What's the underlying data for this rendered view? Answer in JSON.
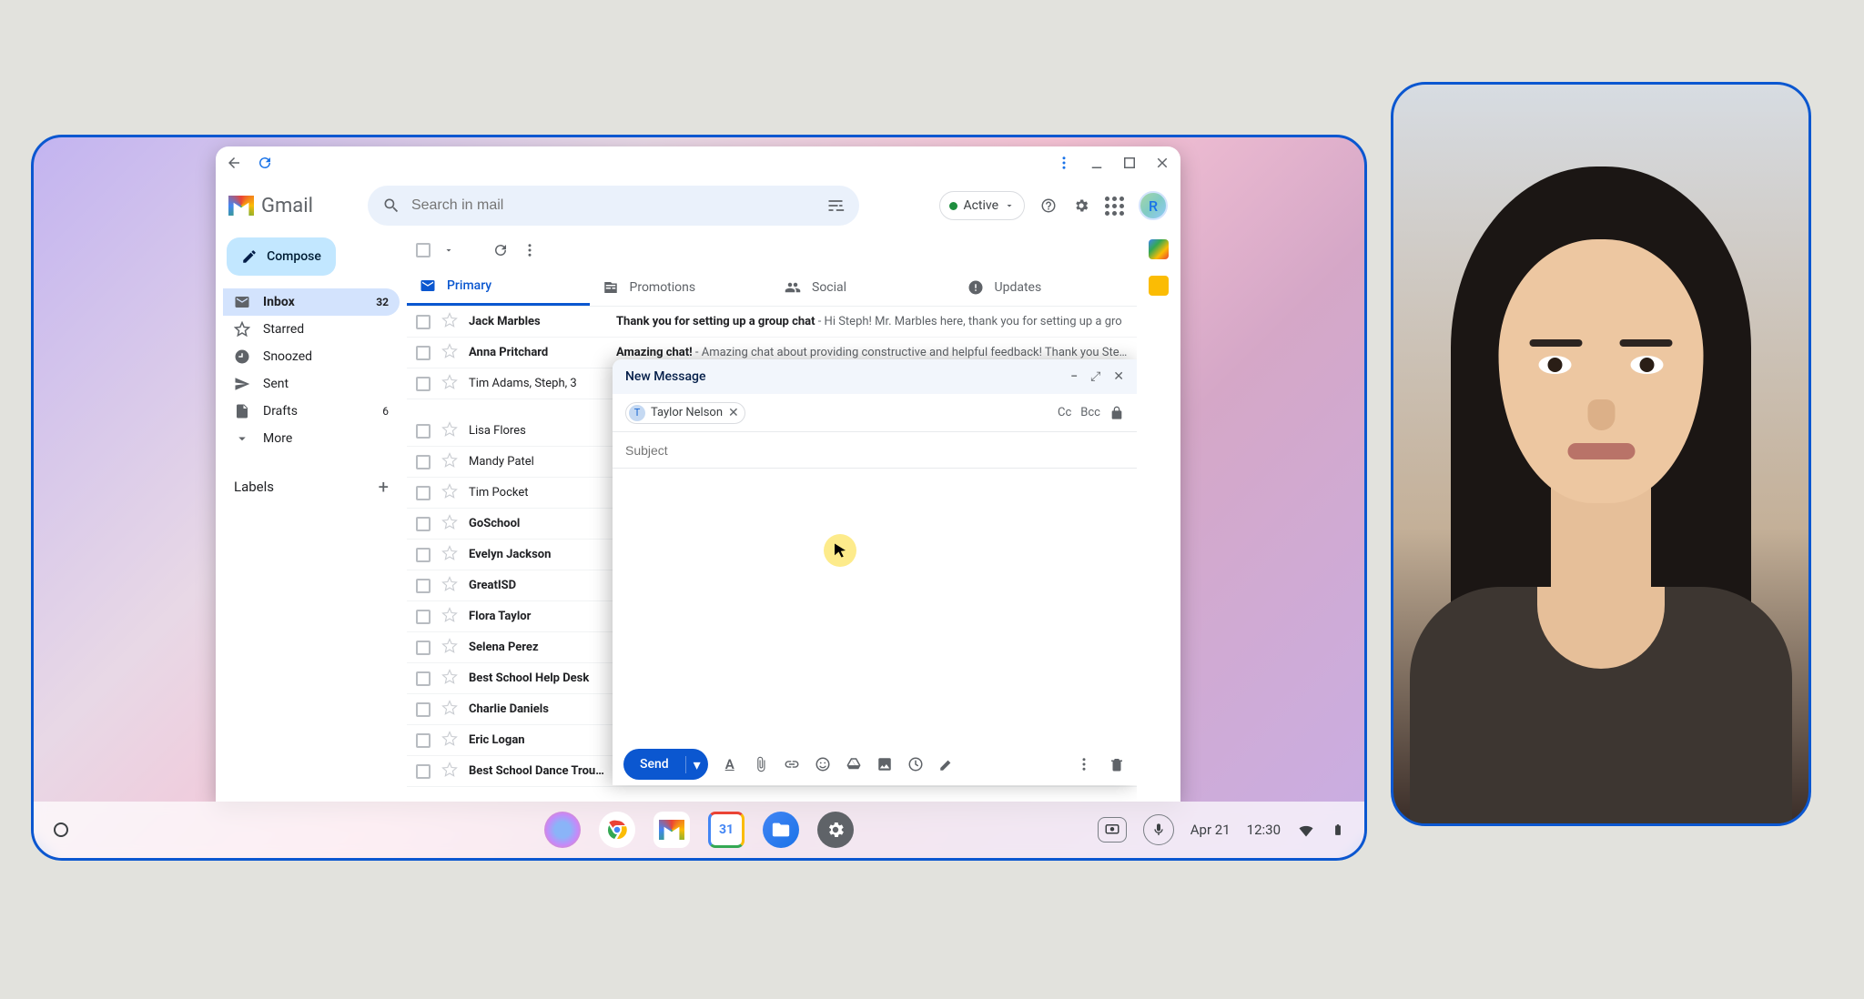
{
  "app": {
    "name": "Gmail"
  },
  "search": {
    "placeholder": "Search in mail"
  },
  "status": {
    "label": "Active"
  },
  "avatar": {
    "initial": "R"
  },
  "compose_button": "Compose",
  "sidebar": {
    "items": [
      {
        "label": "Inbox",
        "count": "32"
      },
      {
        "label": "Starred"
      },
      {
        "label": "Snoozed"
      },
      {
        "label": "Sent"
      },
      {
        "label": "Drafts",
        "count": "6"
      },
      {
        "label": "More"
      }
    ],
    "labels_header": "Labels"
  },
  "tabs": [
    {
      "label": "Primary"
    },
    {
      "label": "Promotions"
    },
    {
      "label": "Social"
    },
    {
      "label": "Updates"
    }
  ],
  "emails": [
    {
      "sender": "Jack Marbles",
      "subject": "Thank you for setting up a group chat",
      "preview": " - Hi Steph! Mr. Marbles here, thank you for setting up a gro",
      "unread": true
    },
    {
      "sender": "Anna Pritchard",
      "subject": "Amazing chat!",
      "preview": " - Amazing chat about providing constructive and helpful feedback! Thank you Stepi",
      "unread": true
    },
    {
      "sender": "Tim Adams, Steph, 3",
      "subject": "",
      "preview": "",
      "unread": false
    },
    {
      "sender": "Lisa Flores",
      "subject": "",
      "preview": "",
      "unread": false
    },
    {
      "sender": "Mandy Patel",
      "subject": "",
      "preview": "",
      "unread": false
    },
    {
      "sender": "Tim Pocket",
      "subject": "",
      "preview": "",
      "unread": false
    },
    {
      "sender": "GoSchool",
      "subject": "",
      "preview": "",
      "unread": true
    },
    {
      "sender": "Evelyn Jackson",
      "subject": "",
      "preview": "",
      "unread": true
    },
    {
      "sender": "GreatISD",
      "subject": "",
      "preview": "",
      "unread": true
    },
    {
      "sender": "Flora Taylor",
      "subject": "",
      "preview": "",
      "unread": true
    },
    {
      "sender": "Selena Perez",
      "subject": "",
      "preview": "",
      "unread": true
    },
    {
      "sender": "Best School Help Desk",
      "subject": "",
      "preview": "",
      "unread": true
    },
    {
      "sender": "Charlie Daniels",
      "subject": "",
      "preview": "",
      "unread": true
    },
    {
      "sender": "Eric Logan",
      "subject": "",
      "preview": "",
      "unread": true
    },
    {
      "sender": "Best School Dance Troupe",
      "subject": "",
      "preview": "",
      "unread": true
    }
  ],
  "compose_dialog": {
    "title": "New Message",
    "recipient": {
      "name": "Taylor Nelson",
      "initial": "T"
    },
    "cc": "Cc",
    "bcc": "Bcc",
    "subject_placeholder": "Subject",
    "send": "Send"
  },
  "shelf": {
    "date": "Apr 21",
    "time": "12:30"
  }
}
